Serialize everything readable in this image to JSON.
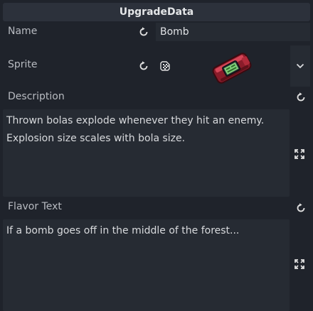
{
  "header": {
    "title": "UpgradeData"
  },
  "properties": {
    "name": {
      "label": "Name",
      "value": "Bomb"
    },
    "sprite": {
      "label": "Sprite"
    },
    "description": {
      "label": "Description",
      "value": "Thrown bolas explode whenever they hit an enemy.\nExplosion size scales with bola size."
    },
    "flavor_text": {
      "label": "Flavor Text",
      "value": "If a bomb goes off in the middle of the forest..."
    }
  },
  "icons": {
    "revert": "reload-icon",
    "checker": "texture-checker-icon",
    "dropdown": "chevron-down-icon",
    "expand": "expand-icon",
    "sprite": "bomb-sprite"
  },
  "colors": {
    "panel_bg": "#1f232b",
    "field_bg": "#262b33",
    "header_bg": "#2c313b"
  }
}
